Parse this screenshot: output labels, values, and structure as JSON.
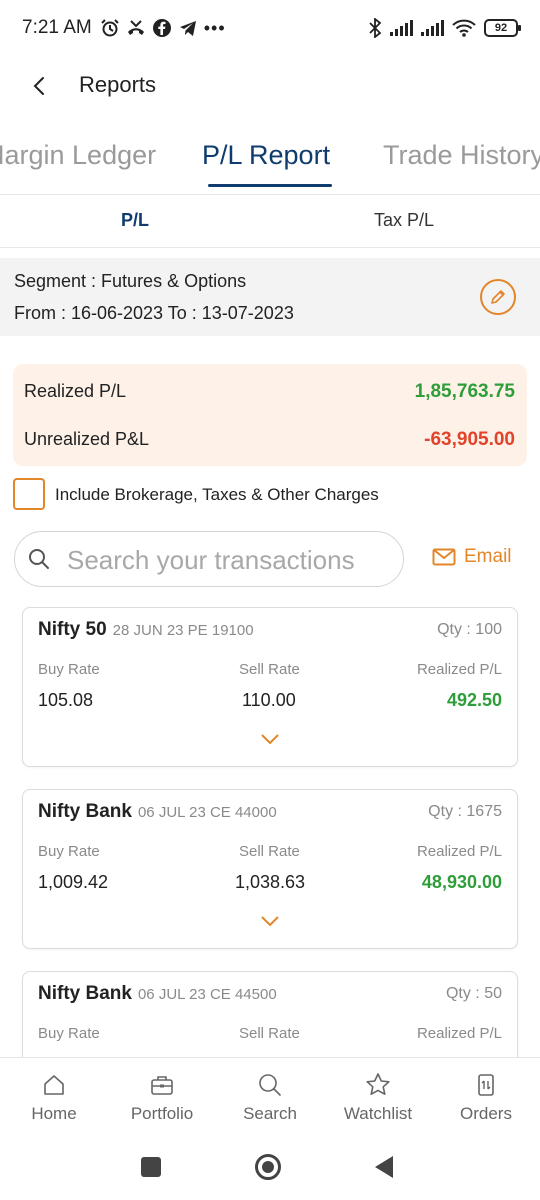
{
  "status_bar": {
    "time": "7:21 AM",
    "battery": "92"
  },
  "header": {
    "title": "Reports"
  },
  "main_tabs": [
    {
      "label": "Margin Ledger"
    },
    {
      "label": "P/L Report"
    },
    {
      "label": "Trade History"
    }
  ],
  "sub_tabs": [
    {
      "label": "P/L"
    },
    {
      "label": "Tax P/L"
    }
  ],
  "segment": {
    "label": "Segment : Futures & Options",
    "dates": "From : 16-06-2023  To : 13-07-2023"
  },
  "summary": {
    "realized_label": "Realized P/L",
    "realized_value": "1,85,763.75",
    "unrealized_label": "Unrealized P&L",
    "unrealized_value": "-63,905.00"
  },
  "include_charges_label": "Include Brokerage, Taxes & Other Charges",
  "search": {
    "placeholder": "Search your transactions"
  },
  "email_label": "Email",
  "column_headers": {
    "buy": "Buy Rate",
    "sell": "Sell Rate",
    "pl": "Realized P/L"
  },
  "transactions": [
    {
      "symbol": "Nifty 50",
      "contract": "28 JUN 23 PE 19100",
      "qty": "Qty : 100",
      "buy_rate": "105.08",
      "sell_rate": "110.00",
      "realized_pl": "492.50"
    },
    {
      "symbol": "Nifty Bank",
      "contract": "06 JUL 23 CE 44000",
      "qty": "Qty : 1675",
      "buy_rate": "1,009.42",
      "sell_rate": "1,038.63",
      "realized_pl": "48,930.00"
    },
    {
      "symbol": "Nifty Bank",
      "contract": "06 JUL 23 CE 44500",
      "qty": "Qty : 50",
      "buy_rate": "",
      "sell_rate": "",
      "realized_pl": ""
    }
  ],
  "bottom_nav": [
    {
      "label": "Home",
      "icon": "home-icon"
    },
    {
      "label": "Portfolio",
      "icon": "briefcase-icon"
    },
    {
      "label": "Search",
      "icon": "search-icon"
    },
    {
      "label": "Watchlist",
      "icon": "star-icon"
    },
    {
      "label": "Orders",
      "icon": "orders-icon"
    }
  ],
  "colors": {
    "primary": "#0f3b6e",
    "accent": "#e3862a",
    "profit": "#2e9e3a",
    "loss": "#e2432a"
  }
}
